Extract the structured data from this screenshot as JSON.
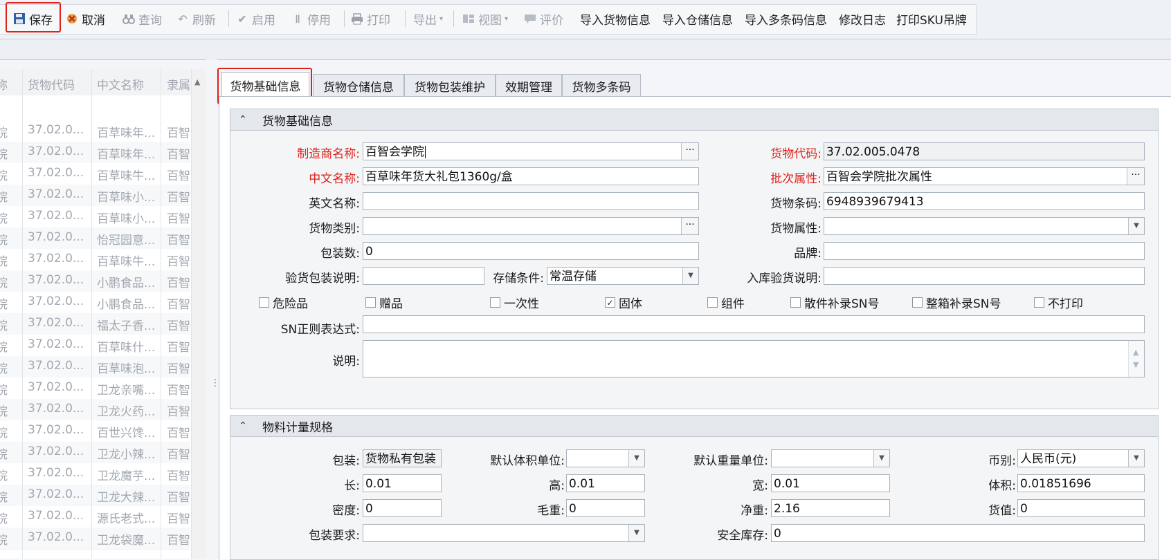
{
  "toolbar": {
    "save": "保存",
    "cancel": "取消",
    "query": "查询",
    "refresh": "刷新",
    "enable": "启用",
    "disable": "停用",
    "print": "打印",
    "export": "导出",
    "view": "视图",
    "rate": "评价",
    "import_goods": "导入货物信息",
    "import_warehouse": "导入仓储信息",
    "import_barcodes": "导入多条码信息",
    "change_log": "修改日志",
    "print_sku": "打印SKU吊牌"
  },
  "grid": {
    "headers": [
      "称",
      "货物代码",
      "中文名称",
      "隶属"
    ],
    "rows": [
      [
        "院",
        "37.02.0...",
        "百草味年...",
        "百智"
      ],
      [
        "院",
        "37.02.0...",
        "百草味年...",
        "百智"
      ],
      [
        "院",
        "37.02.0...",
        "百草味牛...",
        "百智"
      ],
      [
        "院",
        "37.02.0...",
        "百草味小...",
        "百智"
      ],
      [
        "院",
        "37.02.0...",
        "百草味小...",
        "百智"
      ],
      [
        "院",
        "37.02.0...",
        "怡冠园意...",
        "百智"
      ],
      [
        "院",
        "37.02.0...",
        "百草味牛...",
        "百智"
      ],
      [
        "院",
        "37.02.0...",
        "小鹏食品...",
        "百智"
      ],
      [
        "院",
        "37.02.0...",
        "小鹏食品...",
        "百智"
      ],
      [
        "院",
        "37.02.0...",
        "福太子香...",
        "百智"
      ],
      [
        "院",
        "37.02.0...",
        "百草味什...",
        "百智"
      ],
      [
        "院",
        "37.02.0...",
        "百草味泡...",
        "百智"
      ],
      [
        "院",
        "37.02.0...",
        "卫龙亲嘴...",
        "百智"
      ],
      [
        "院",
        "37.02.0...",
        "卫龙火药...",
        "百智"
      ],
      [
        "院",
        "37.02.0...",
        "百世兴馋...",
        "百智"
      ],
      [
        "院",
        "37.02.0...",
        "卫龙小辣...",
        "百智"
      ],
      [
        "院",
        "37.02.0...",
        "卫龙魔芋...",
        "百智"
      ],
      [
        "院",
        "37.02.0...",
        "卫龙大辣...",
        "百智"
      ],
      [
        "院",
        "37.02.0...",
        "源氏老式...",
        "百智"
      ],
      [
        "院",
        "37.02.0...",
        "卫龙袋魔...",
        "百智"
      ]
    ]
  },
  "tabs": [
    "货物基础信息",
    "货物仓储信息",
    "货物包装维护",
    "效期管理",
    "货物多条码"
  ],
  "basic": {
    "title": "货物基础信息",
    "labels": {
      "manufacturer": "制造商名称:",
      "cn_name": "中文名称:",
      "en_name": "英文名称:",
      "category": "货物类别:",
      "pack_count": "包装数:",
      "inspect_pack": "验货包装说明:",
      "storage": "存储条件:",
      "code": "货物代码:",
      "batch": "批次属性:",
      "barcode": "货物条码:",
      "attr": "货物属性:",
      "brand": "品牌:",
      "inbound": "入库验货说明:",
      "sn_regex": "SN正则表达式:",
      "remark": "说明:"
    },
    "values": {
      "manufacturer": "百智会学院",
      "cn_name": "百草味年货大礼包1360g/盒",
      "en_name": "",
      "category": "",
      "pack_count": "0",
      "inspect_pack": "",
      "storage": "常温存储",
      "code": "37.02.005.0478",
      "batch": "百智会学院批次属性",
      "barcode": "6948939679413",
      "attr": "",
      "brand": "",
      "inbound": "",
      "sn_regex": "",
      "remark": ""
    },
    "checks": {
      "dangerous": "危险品",
      "gift": "赠品",
      "disposable": "一次性",
      "solid": "固体",
      "component": "组件",
      "piece_sn": "散件补录SN号",
      "box_sn": "整箱补录SN号",
      "no_print": "不打印"
    }
  },
  "measure": {
    "title": "物料计量规格",
    "labels": {
      "pack": "包装:",
      "vol_unit": "默认体积单位:",
      "wt_unit": "默认重量单位:",
      "currency": "币别:",
      "length": "长:",
      "height": "高:",
      "width": "宽:",
      "volume": "体积:",
      "density": "密度:",
      "gross": "毛重:",
      "net": "净重:",
      "value": "货值:",
      "pack_req": "包装要求:",
      "safety": "安全库存:"
    },
    "values": {
      "pack": "货物私有包装",
      "vol_unit": "",
      "wt_unit": "",
      "currency": "人民币(元)",
      "length": "0.01",
      "height": "0.01",
      "width": "0.01",
      "volume": "0.01851696",
      "density": "0",
      "gross": "0",
      "net": "2.16",
      "value": "0",
      "pack_req": "",
      "safety": "0"
    }
  }
}
